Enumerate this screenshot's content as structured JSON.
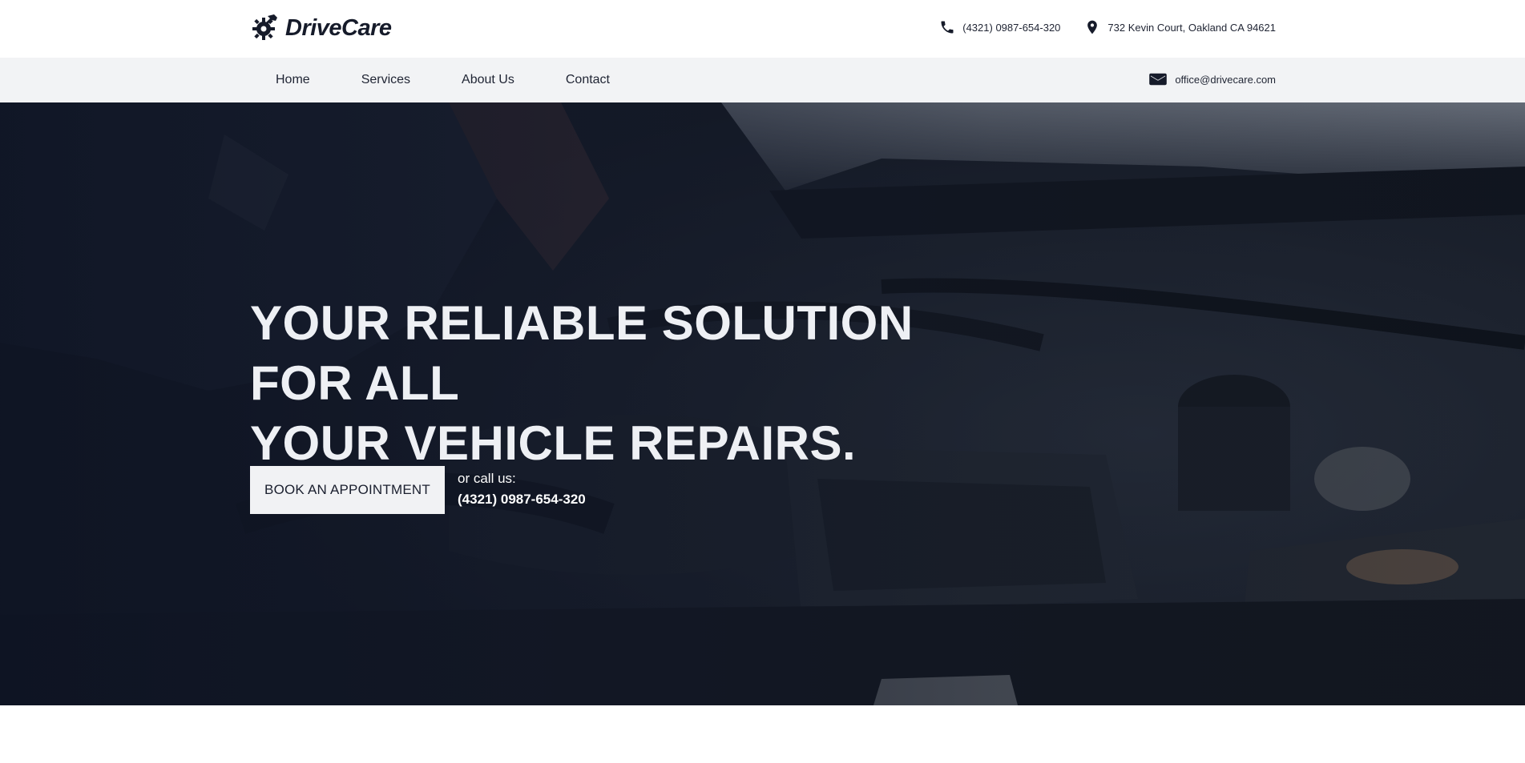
{
  "brand": {
    "name": "DriveCare",
    "logo_icon": "gear-wrench-icon"
  },
  "header": {
    "phone": {
      "icon": "phone-icon",
      "text": "(4321) 0987-654-320"
    },
    "address": {
      "icon": "location-pin-icon",
      "text": "732 Kevin Court, Oakland CA 94621"
    }
  },
  "nav": {
    "items": [
      {
        "label": "Home"
      },
      {
        "label": "Services"
      },
      {
        "label": "About Us"
      },
      {
        "label": "Contact"
      }
    ],
    "email": {
      "icon": "envelope-icon",
      "text": "office@drivecare.com"
    }
  },
  "hero": {
    "title_line1": "YOUR RELIABLE SOLUTION FOR ALL",
    "title_line2": "YOUR VEHICLE REPAIRS.",
    "cta_label": "BOOK AN APPOINTMENT",
    "call_label": "or call us:",
    "call_phone": "(4321) 0987-654-320",
    "background": "car-engine-photo"
  },
  "colors": {
    "brand_dark": "#161b2a",
    "nav_bg": "#f2f3f5",
    "hero_overlay": "#0e1424",
    "button_bg": "#f1f2f4"
  }
}
